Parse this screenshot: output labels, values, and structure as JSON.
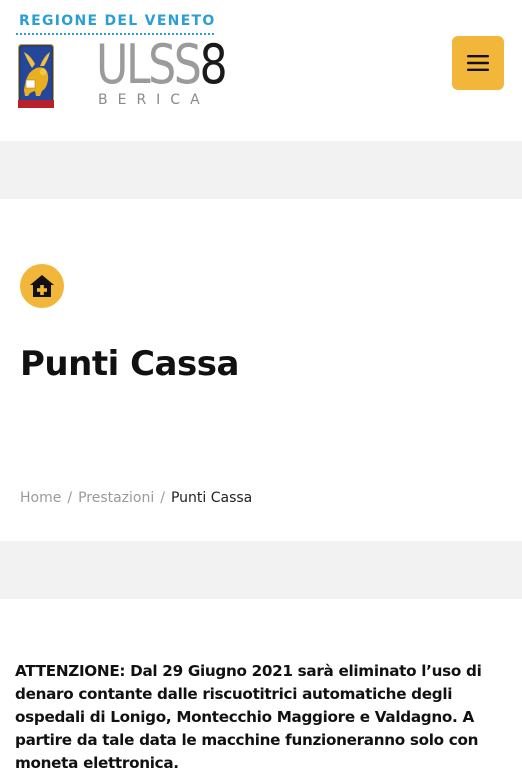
{
  "header": {
    "region_label": "REGIONE DEL VENETO",
    "brand_ulss": "ULSS",
    "brand_number": "8",
    "brand_sub": "BERICA",
    "menu_icon": "hamburger-icon",
    "accent_color": "#f2b63a",
    "region_color": "#2a9fd6"
  },
  "hero": {
    "icon": "home-plus-icon",
    "title": "Punti Cassa"
  },
  "breadcrumb": {
    "items": [
      {
        "label": "Home"
      },
      {
        "label": "Prestazioni"
      }
    ],
    "separator": "/",
    "current": "Punti Cassa"
  },
  "content": {
    "notice": "ATTENZIONE: Dal 29 Giugno 2021 sarà eliminato l’uso di denaro contante dalle riscuotitrici automatiche degli ospedali di Lonigo, Montecchio Maggiore e Valdagno. A partire da tale data le macchine funzioneranno solo con moneta elettronica."
  }
}
